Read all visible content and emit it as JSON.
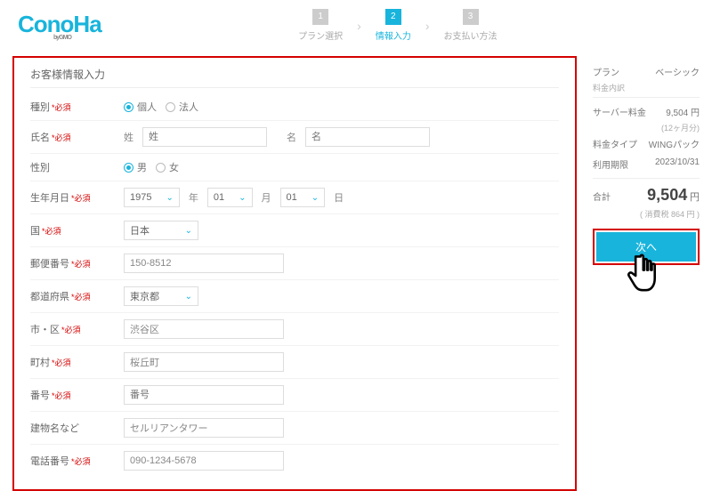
{
  "header": {
    "logo_main": "ConoHa",
    "logo_sub": "byGMO",
    "steps": [
      {
        "num": "1",
        "label": "プラン選択"
      },
      {
        "num": "2",
        "label": "情報入力"
      },
      {
        "num": "3",
        "label": "お支払い方法"
      }
    ]
  },
  "form": {
    "title": "お客様情報入力",
    "required": "*必須",
    "type_label": "種別",
    "type_opt1": "個人",
    "type_opt2": "法人",
    "name_label": "氏名",
    "name_sei_lbl": "姓",
    "name_sei_ph": "姓",
    "name_mei_lbl": "名",
    "name_mei_ph": "名",
    "gender_label": "性別",
    "gender_opt1": "男",
    "gender_opt2": "女",
    "birth_label": "生年月日",
    "birth_year": "1975",
    "birth_year_u": "年",
    "birth_month": "01",
    "birth_month_u": "月",
    "birth_day": "01",
    "birth_day_u": "日",
    "country_label": "国",
    "country_val": "日本",
    "postal_label": "郵便番号",
    "postal_val": "150-8512",
    "pref_label": "都道府県",
    "pref_val": "東京都",
    "city_label": "市・区",
    "city_val": "渋谷区",
    "town_label": "町村",
    "town_val": "桜丘町",
    "num_label": "番号",
    "num_ph": "番号",
    "bldg_label": "建物名など",
    "bldg_val": "セルリアンタワー",
    "phone_label": "電話番号",
    "phone_val": "090-1234-5678"
  },
  "summary": {
    "plan_l": "プラン",
    "plan_v": "ベーシック",
    "breakdown": "料金内訳",
    "server_l": "サーバー料金",
    "server_v": "9,504 円",
    "server_note": "(12ヶ月分)",
    "type_l": "料金タイプ",
    "type_v": "WINGパック",
    "period_l": "利用期限",
    "period_v": "2023/10/31",
    "total_l": "合計",
    "total_v": "9,504",
    "total_u": "円",
    "tax_note": "( 消費税 864 円 )",
    "next": "次へ"
  }
}
